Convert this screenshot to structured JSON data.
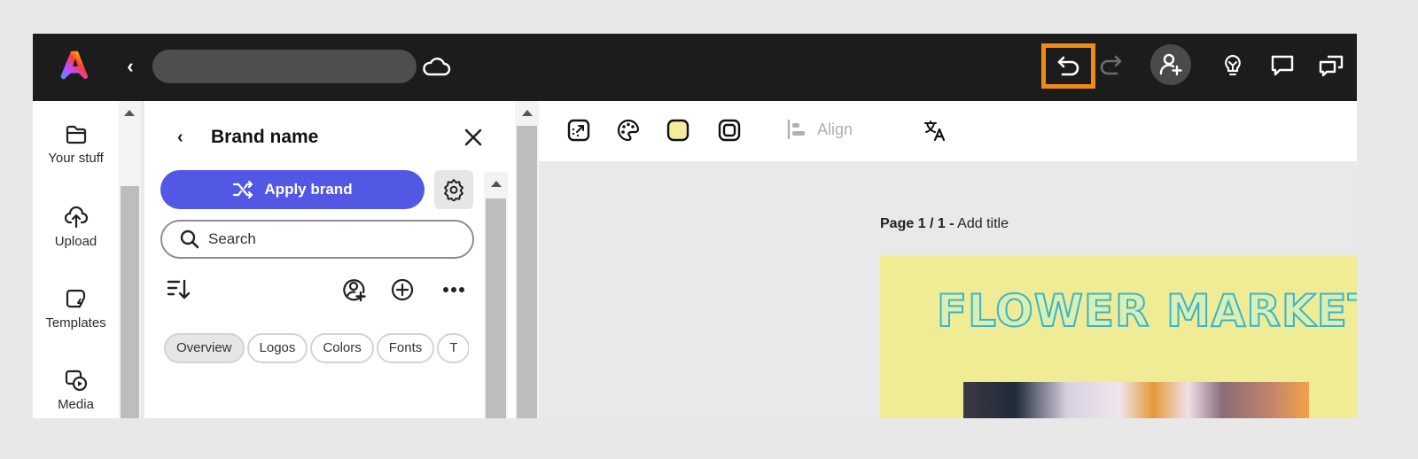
{
  "topbar": {
    "logo": "adobe-express-logo",
    "back_icon": "chevron-left-icon",
    "document_title": "",
    "cloud_icon": "cloud-icon",
    "undo_icon": "undo-icon",
    "redo_icon": "redo-icon",
    "invite_icon": "add-user-icon",
    "tips_icon": "lightbulb-icon",
    "comment_icon": "comment-icon",
    "chat_icon": "chat-bubbles-icon",
    "highlight_color": "#f08c16"
  },
  "rail": {
    "items": [
      {
        "label": "Your stuff",
        "icon": "folder-icon"
      },
      {
        "label": "Upload",
        "icon": "cloud-upload-icon"
      },
      {
        "label": "Templates",
        "icon": "templates-icon"
      },
      {
        "label": "Media",
        "icon": "media-icon"
      }
    ]
  },
  "brand_panel": {
    "title": "Brand name",
    "apply_label": "Apply brand",
    "apply_color": "#5258e4",
    "search_placeholder": "Search",
    "chips": [
      {
        "label": "Overview",
        "active": true
      },
      {
        "label": "Logos",
        "active": false
      },
      {
        "label": "Colors",
        "active": false
      },
      {
        "label": "Fonts",
        "active": false
      },
      {
        "label": "T",
        "active": false
      }
    ]
  },
  "toolbar": {
    "align_label": "Align",
    "fill_color": "#f3ec9c"
  },
  "canvas": {
    "page_label": "Page 1 / 1 -",
    "page_title": "Add title",
    "design_title": "FLOWER MARKET",
    "page_background": "#f0ec96"
  }
}
